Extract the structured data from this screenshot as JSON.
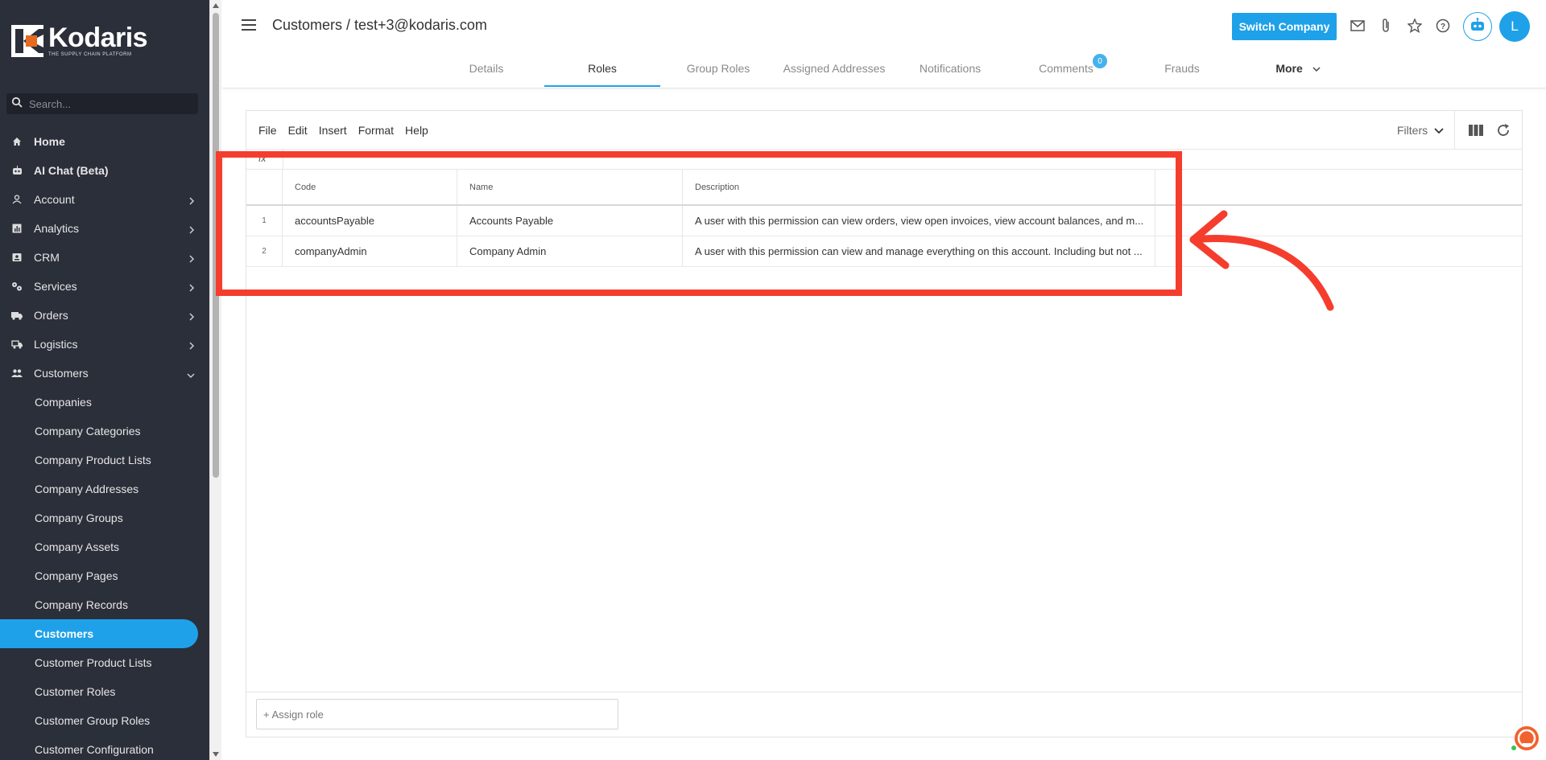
{
  "sidebar": {
    "logo": "Kodaris",
    "logo_tagline": "THE SUPPLY CHAIN PLATFORM",
    "search_placeholder": "Search...",
    "items": [
      {
        "label": "Home",
        "icon": "home-icon",
        "chevron": false
      },
      {
        "label": "AI Chat (Beta)",
        "icon": "robot-icon",
        "chevron": false
      },
      {
        "label": "Account",
        "icon": "person-icon",
        "chevron": true
      },
      {
        "label": "Analytics",
        "icon": "chart-icon",
        "chevron": true
      },
      {
        "label": "CRM",
        "icon": "contact-card-icon",
        "chevron": true
      },
      {
        "label": "Services",
        "icon": "gears-icon",
        "chevron": true
      },
      {
        "label": "Orders",
        "icon": "truck-icon",
        "chevron": true
      },
      {
        "label": "Logistics",
        "icon": "delivery-icon",
        "chevron": true
      },
      {
        "label": "Customers",
        "icon": "people-icon",
        "chevron": "open"
      }
    ],
    "sub_items": [
      "Companies",
      "Company Categories",
      "Company Product Lists",
      "Company Addresses",
      "Company Groups",
      "Company Assets",
      "Company Pages",
      "Company Records",
      "Customers",
      "Customer Product Lists",
      "Customer Roles",
      "Customer Group Roles",
      "Customer Configuration"
    ],
    "active_sub": "Customers"
  },
  "header": {
    "breadcrumb": "Customers / test+3@kodaris.com",
    "switch_company": "Switch Company",
    "avatar_letter": "L",
    "tabs": [
      "Details",
      "Roles",
      "Group Roles",
      "Assigned Addresses",
      "Notifications",
      "Comments",
      "Frauds",
      "More"
    ],
    "active_tab": "Roles",
    "comments_badge": "0"
  },
  "grid": {
    "menu": [
      "File",
      "Edit",
      "Insert",
      "Format",
      "Help"
    ],
    "filters_label": "Filters",
    "fx_label": "fx",
    "columns": [
      "Code",
      "Name",
      "Description"
    ],
    "rows": [
      {
        "num": "1",
        "code": "accountsPayable",
        "name": "Accounts Payable",
        "description": "A user with this permission can view orders, view open invoices, view account balances, and m..."
      },
      {
        "num": "2",
        "code": "companyAdmin",
        "name": "Company Admin",
        "description": "A user with this permission can view and manage everything on this account. Including but not ..."
      }
    ],
    "assign_role": "+ Assign role"
  },
  "colors": {
    "accent": "#1ea1e8",
    "sidebar_bg": "#2b2f3a",
    "annotation": "#f53d2d"
  }
}
